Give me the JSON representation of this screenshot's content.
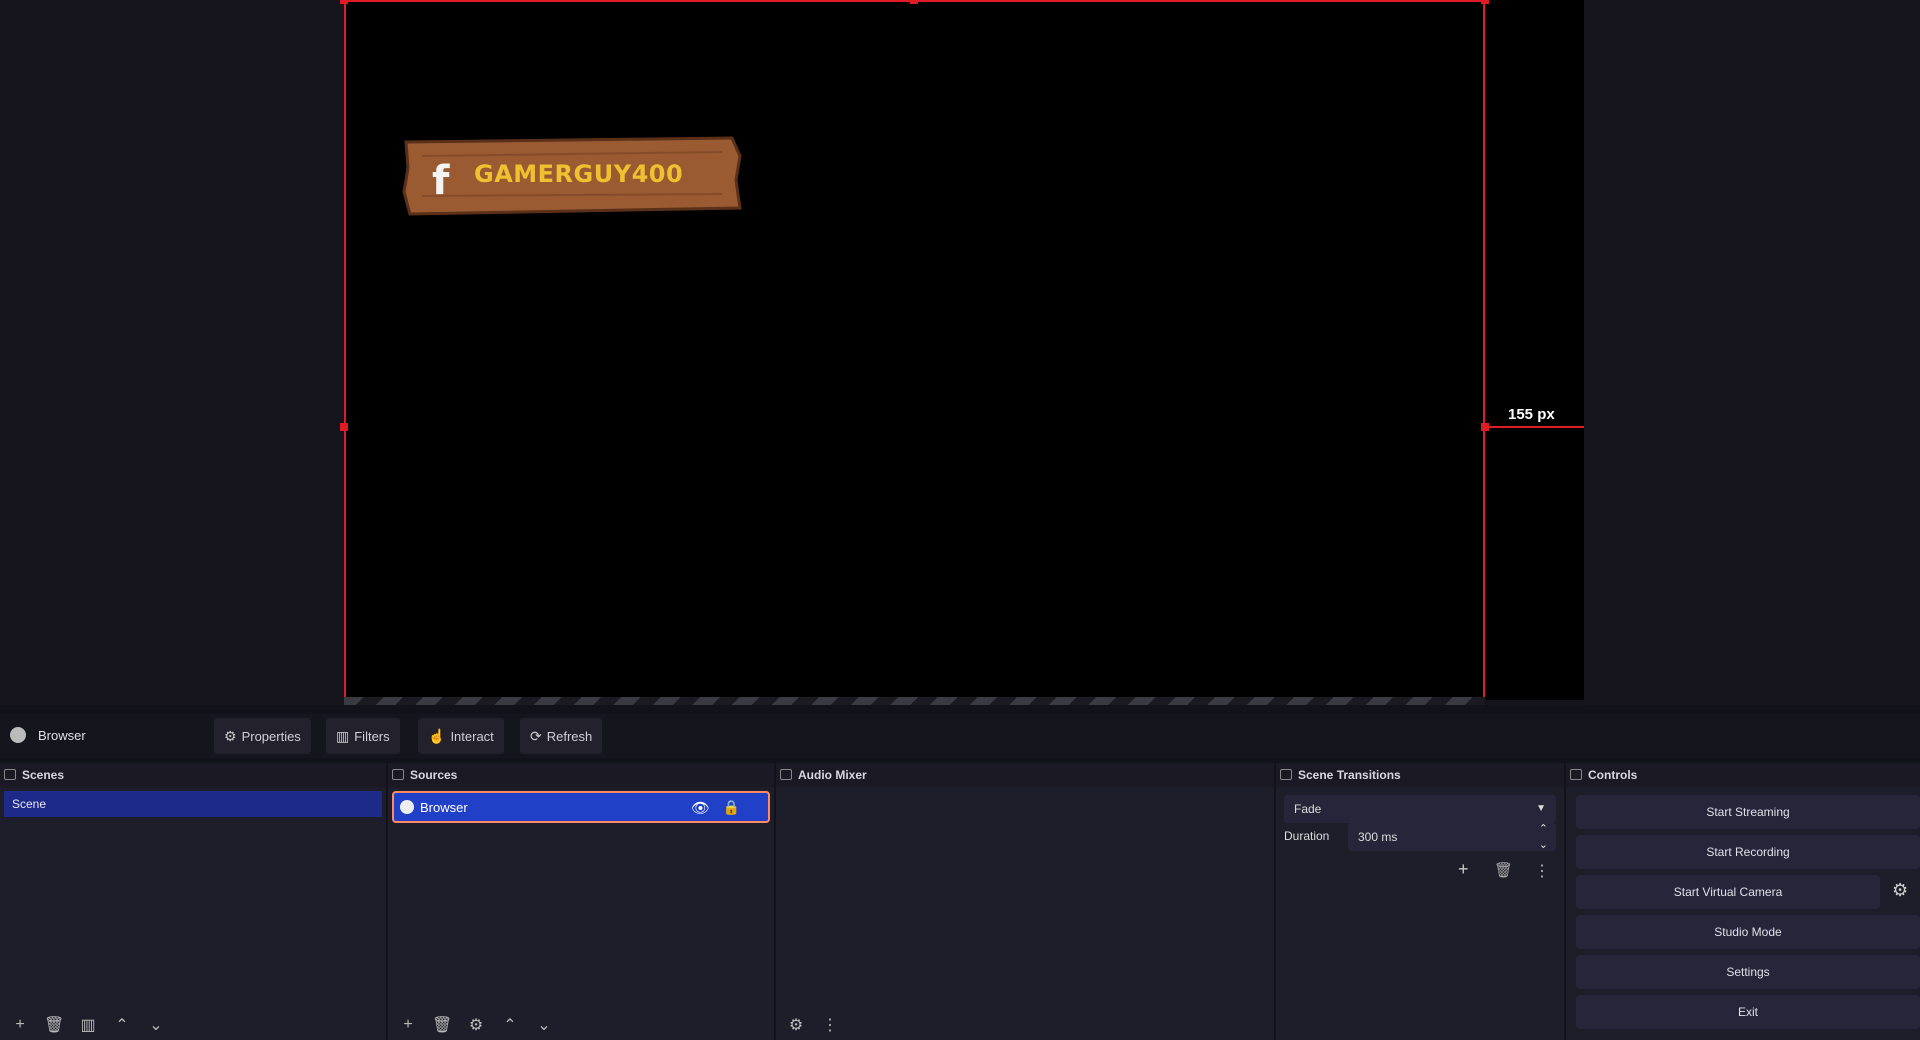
{
  "preview": {
    "dimension_label": "155 px",
    "banner_text": "GAMERGUY400",
    "banner_icon": "facebook-icon"
  },
  "source_toolbar": {
    "source_name": "Browser",
    "properties": "Properties",
    "filters": "Filters",
    "interact": "Interact",
    "refresh": "Refresh"
  },
  "docks": {
    "scenes": {
      "title": "Scenes",
      "items": [
        "Scene"
      ]
    },
    "sources": {
      "title": "Sources",
      "items": [
        "Browser"
      ]
    },
    "audio_mixer": {
      "title": "Audio Mixer"
    },
    "scene_transitions": {
      "title": "Scene Transitions",
      "transition": "Fade",
      "duration_label": "Duration",
      "duration_value": "300 ms"
    },
    "controls": {
      "title": "Controls",
      "start_streaming": "Start Streaming",
      "start_recording": "Start Recording",
      "start_virtual_camera": "Start Virtual Camera",
      "studio_mode": "Studio Mode",
      "settings": "Settings",
      "exit": "Exit"
    }
  },
  "colors": {
    "selection": "#e01b24",
    "scene_selected": "#1d2a8a",
    "source_selected": "#2140c8",
    "banner_text": "#f0c030"
  }
}
